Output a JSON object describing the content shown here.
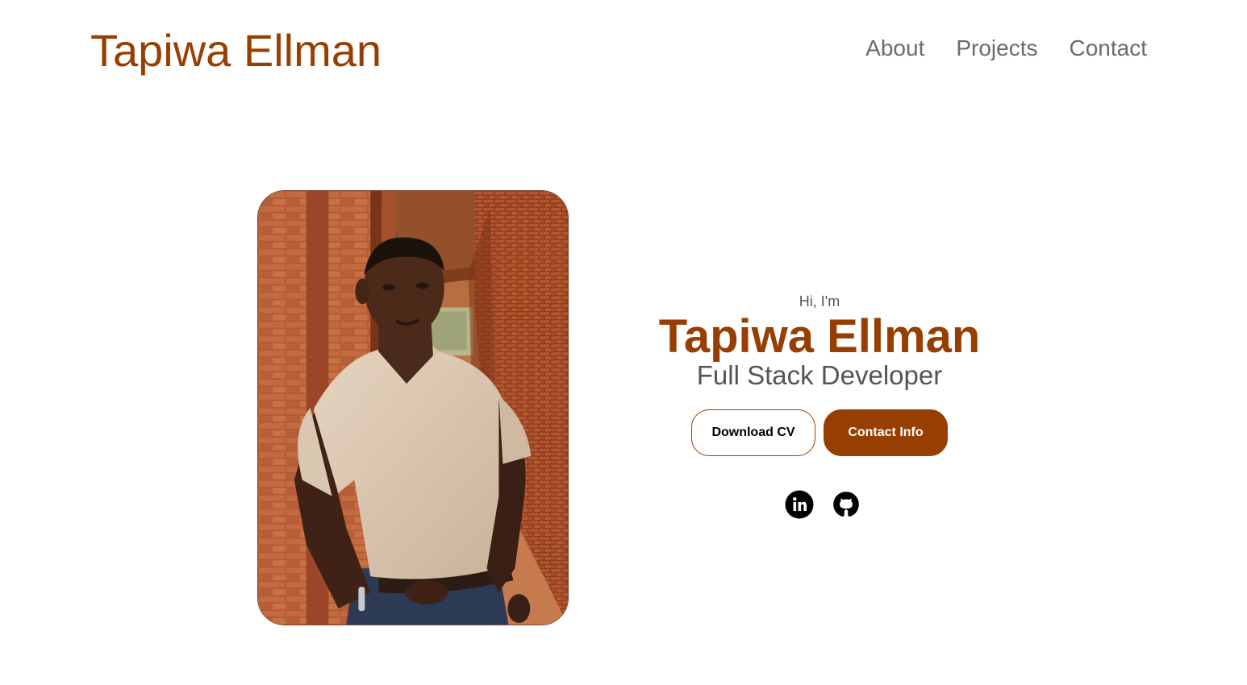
{
  "nav": {
    "logo": "Tapiwa Ellman",
    "links": [
      {
        "label": "About"
      },
      {
        "label": "Projects"
      },
      {
        "label": "Contact"
      }
    ]
  },
  "hero": {
    "photo_alt": "Profile picture",
    "greeting": "Hi, I'm",
    "name": "Tapiwa Ellman",
    "role": "Full Stack Developer",
    "buttons": {
      "download": "Download CV",
      "contact": "Contact Info"
    },
    "socials": [
      {
        "icon": "linkedin-icon"
      },
      {
        "icon": "github-icon"
      }
    ]
  },
  "colors": {
    "brand": "#973f02",
    "nav_text": "#6b6b6b",
    "body_text": "#555555"
  }
}
